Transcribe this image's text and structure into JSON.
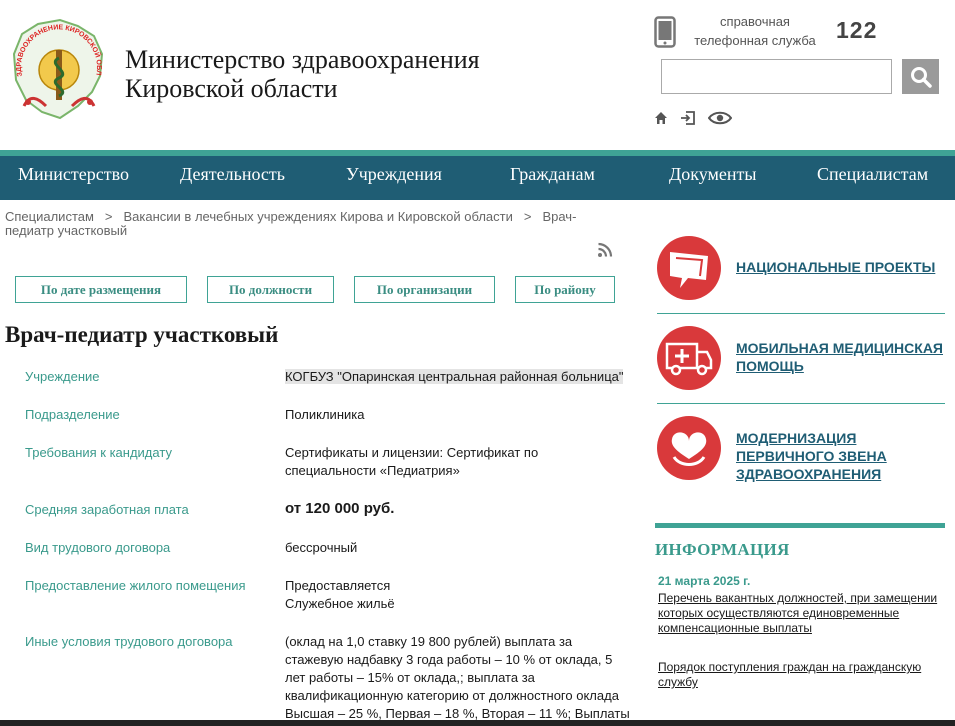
{
  "header": {
    "logo_text": "ЗДРАВООХРАНЕНИЕ КИРОВСКОЙ ОБЛАСТИ",
    "title_line1": "Министерство здравоохранения",
    "title_line2": "Кировской области",
    "help_line1": "справочная",
    "help_line2": "телефонная служба",
    "help_number": "122",
    "search_value": "",
    "search_placeholder": ""
  },
  "nav": {
    "items": [
      "Министерство",
      "Деятельность",
      "Учреждения",
      "Гражданам",
      "Документы",
      "Специалистам"
    ]
  },
  "breadcrumb": {
    "items": [
      "Специалистам",
      "Вакансии в лечебных учреждениях Кирова и Кировской области",
      "Врач-педиатр участковый"
    ],
    "separator": ">"
  },
  "filters": [
    "По дате размещения",
    "По должности",
    "По организации",
    "По району"
  ],
  "vacancy": {
    "title": "Врач-педиатр участковый",
    "fields": [
      {
        "label": "Учреждение",
        "value": "КОГБУЗ \"Опаринская центральная районная больница\""
      },
      {
        "label": "Подразделение",
        "value": "Поликлиника"
      },
      {
        "label": "Требования к кандидату",
        "value": "Сертификаты и лицензии: Сертификат по специальности «Педиатрия»"
      },
      {
        "label": "Средняя заработная плата",
        "value": "от 120 000 руб."
      },
      {
        "label": "Вид трудового договора",
        "value": "бессрочный"
      },
      {
        "label": "Предоставление жилого помещения",
        "value": "Предоставляется\nСлужебное жильё"
      },
      {
        "label": "Иные условия трудового договора",
        "value": "(оклад на 1,0 ставку 19 800 рублей) выплата за стажевую надбавку 3 года работы – 10 % от оклада, 5 лет работы – 15% от оклада,; выплата за квалификационную категорию от должностного оклада Высшая – 25 %, Первая – 18 %, Вторая – 11 %; Выплаты"
      }
    ]
  },
  "projects": [
    {
      "label": "НАЦИОНАЛЬНЫЕ ПРОЕКТЫ",
      "icon": "flag-icon"
    },
    {
      "label": "МОБИЛЬНАЯ МЕДИЦИНСКАЯ ПОМОЩЬ",
      "icon": "ambulance-icon"
    },
    {
      "label": "МОДЕРНИЗАЦИЯ ПЕРВИЧНОГО ЗВЕНА ЗДРАВООХРАНЕНИЯ",
      "icon": "heart-icon"
    }
  ],
  "info": {
    "title": "ИНФОРМАЦИЯ",
    "date": "21 марта 2025 г.",
    "links": [
      "Перечень вакантных должностей, при замещении которых осуществляются единовременные компенсационные выплаты",
      "Порядок поступления граждан на гражданскую службу"
    ]
  },
  "colors": {
    "nav_bg": "#1f5d74",
    "accent_teal": "#3fa395",
    "label_teal": "#3a9a8c",
    "project_red": "#d9393b"
  }
}
